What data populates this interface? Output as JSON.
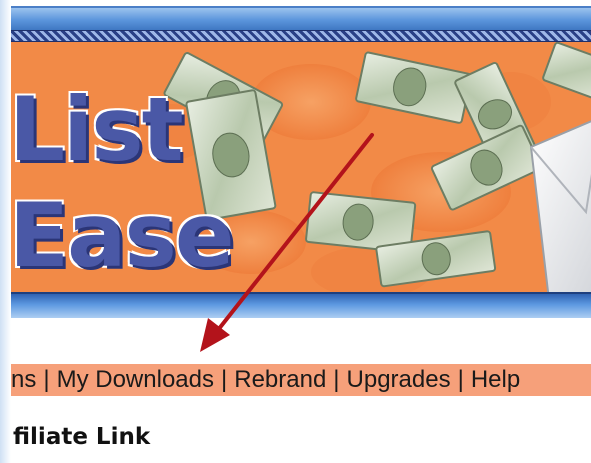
{
  "banner": {
    "logo_line1": "List",
    "logo_line2": "Ease"
  },
  "nav": {
    "items": [
      {
        "label": "ns"
      },
      {
        "label": "My Downloads"
      },
      {
        "label": "Rebrand"
      },
      {
        "label": "Upgrades"
      },
      {
        "label": "Help"
      }
    ],
    "separator": "|"
  },
  "section": {
    "title": "filiate Link"
  },
  "colors": {
    "banner_orange": "#f48f4f",
    "nav_background": "#f6a07a",
    "banner_blue": "#5b95dc",
    "logo_purple": "#4a58a6",
    "arrow_red": "#b3131b"
  },
  "icons": [
    "dollar-bill-icon",
    "envelope-icon",
    "red-arrow-annotation"
  ]
}
